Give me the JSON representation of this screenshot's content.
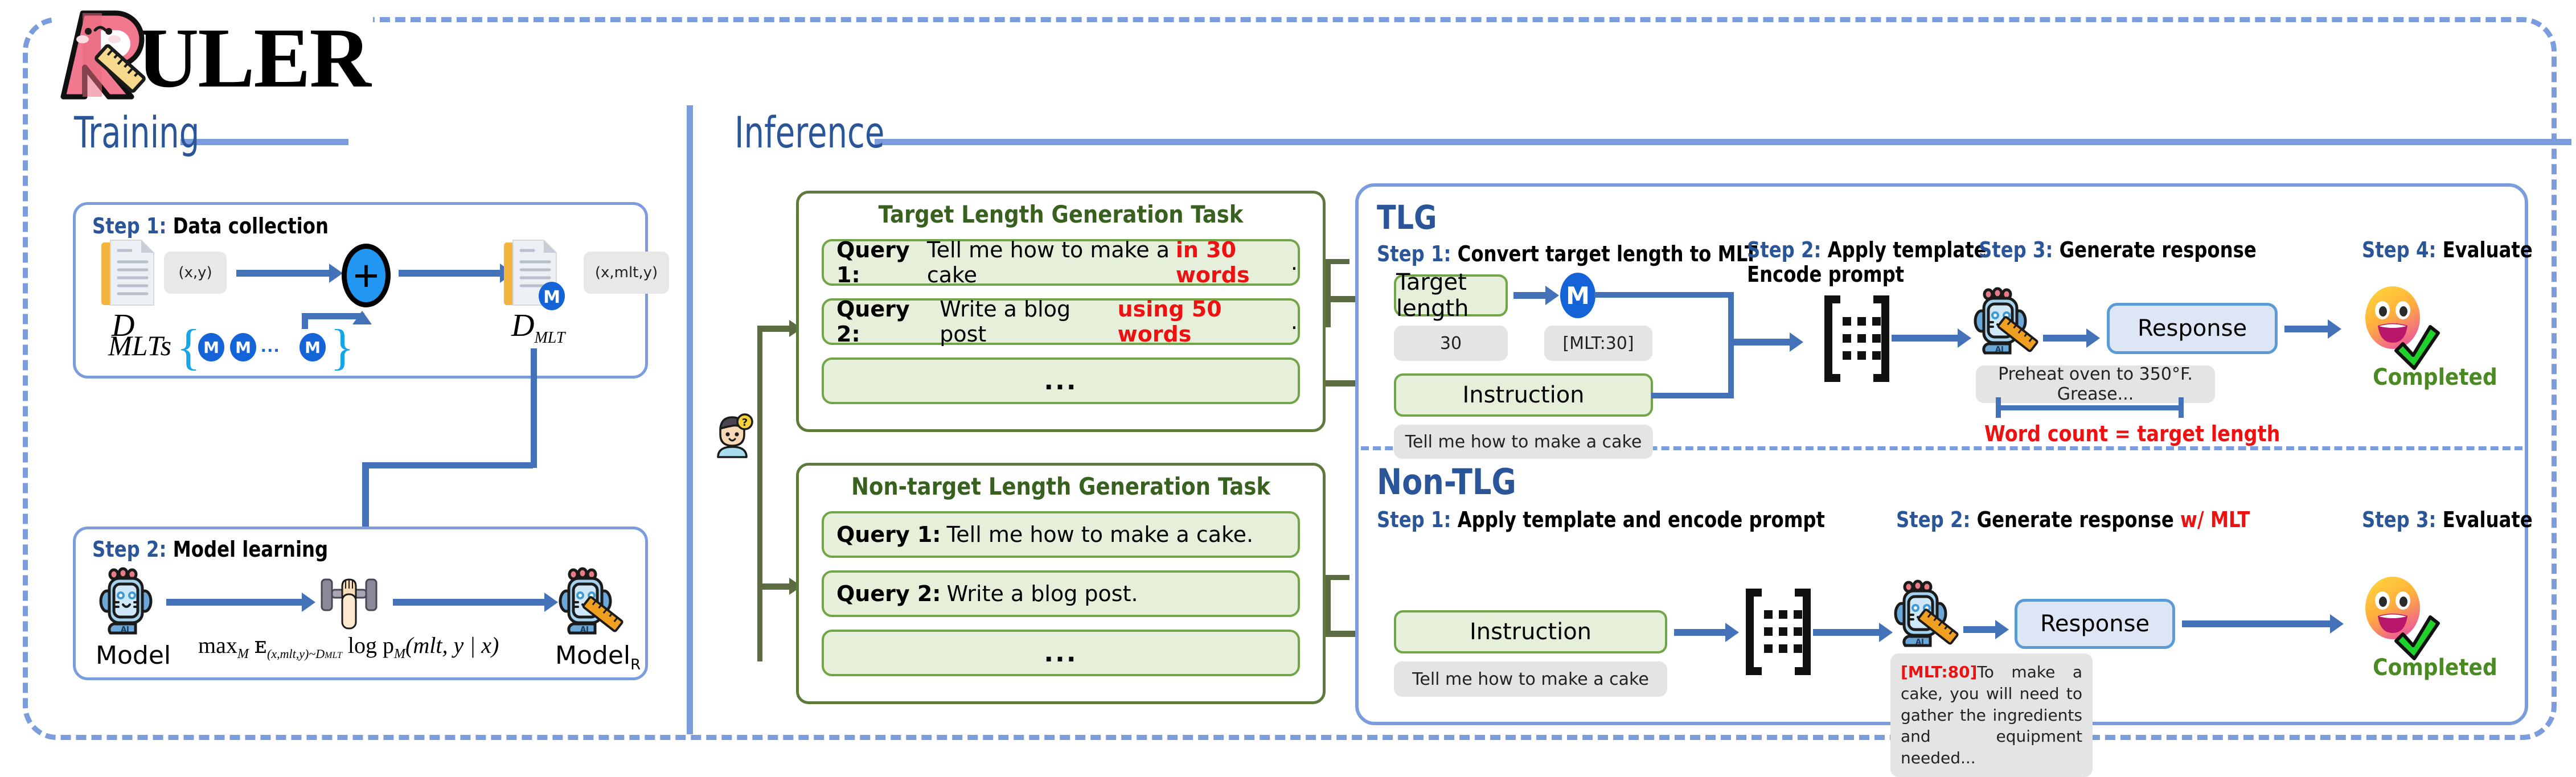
{
  "logo": {
    "letter": "R",
    "text": "ULER"
  },
  "sections": {
    "training": {
      "label": "Training"
    },
    "inference": {
      "label": "Inference"
    }
  },
  "training": {
    "step1": {
      "step_label": "Step 1:",
      "title": " Data collection",
      "dataset_symbol": "D",
      "dataset_pair": "(x,y)",
      "mlt_dataset_symbol": "D",
      "mlt_dataset_subscript": "MLT",
      "mlt_pair": "(x,mlt,y)",
      "plus": "+",
      "mlts_label": "MLTs",
      "mlts_open": "{",
      "mlts_close": "}",
      "mlt_badge": "M",
      "mlts_ellipsis": "..."
    },
    "step2": {
      "step_label": "Step 2:",
      "title": " Model learning",
      "model_in": "Model",
      "model_out": "Model",
      "model_out_sub": "R",
      "objective": "max",
      "objective_sub1": "M",
      "objective_e": "ᴇ",
      "objective_sub2": "(x,mlt,y)~D",
      "objective_sub3": "MLT",
      "objective_rest": "log p",
      "objective_p_sub": "M",
      "objective_args": "(mlt, y | x)"
    }
  },
  "inference": {
    "user_icon": "person-question-icon",
    "target_task": {
      "title": "Target Length Generation Task",
      "queries": [
        {
          "label": "Query 1:",
          "text": "Tell me how to make a cake",
          "highlight": "in 30 words",
          "suffix": "."
        },
        {
          "label": "Query 2:",
          "text": "Write a blog post",
          "highlight": "using 50 words",
          "suffix": "."
        },
        {
          "label": "",
          "text": "",
          "highlight": "",
          "suffix": "",
          "ellipsis": "..."
        }
      ]
    },
    "nontarget_task": {
      "title": "Non-target Length Generation Task",
      "queries": [
        {
          "label": "Query 1:",
          "text": "Tell me how to make a cake.",
          "highlight": "",
          "suffix": ""
        },
        {
          "label": "Query 2:",
          "text": "Write a blog post.",
          "highlight": "",
          "suffix": ""
        },
        {
          "label": "",
          "text": "",
          "highlight": "",
          "suffix": "",
          "ellipsis": "..."
        }
      ]
    },
    "tlg": {
      "heading": "TLG",
      "step1_label": "Step 1:",
      "step1_title": " Convert target length to MLT",
      "target_length_box": "Target length",
      "target_length_value": "30",
      "mlt_token": "[MLT:30]",
      "m_badge": "M",
      "instruction_box": "Instruction",
      "instruction_value": "Tell me how to make a cake",
      "step2_label": "Step 2:",
      "step2_title_line1": " Apply template",
      "step2_title_line2": "Encode prompt",
      "step3_label": "Step 3:",
      "step3_title": " Generate response",
      "response_box": "Response",
      "response_value": "Preheat oven to 350°F. Grease...",
      "measure_note": "Word count = target length",
      "step4_label": "Step 4:",
      "step4_title": " Evaluate",
      "completed": "Completed"
    },
    "nontlg": {
      "heading": "Non-TLG",
      "step1_label": "Step 1:",
      "step1_title": " Apply template and encode prompt",
      "instruction_box": "Instruction",
      "instruction_value": "Tell me how to make a cake",
      "step2_label": "Step 2:",
      "step2_title": " Generate response ",
      "step2_title_red": "w/ MLT",
      "response_box": "Response",
      "response_tag": "[MLT:80]",
      "response_value": "To make a cake, you will need to gather the ingredients and equipment needed...",
      "step3_label": "Step 3:",
      "step3_title": " Evaluate",
      "completed": "Completed"
    }
  },
  "colors": {
    "frame_blue": "#7b9ddd",
    "heading_blue": "#2a5699",
    "arrow_blue": "#4472b8",
    "green_border": "#72a548",
    "green_fill": "#e6efd9",
    "task_border": "#5d7a3c",
    "task_title": "#38601f",
    "red": "#ee1111",
    "completed_green": "#4a8a22",
    "badge_blue": "#1464d8",
    "gray_pill": "#e4e4e4",
    "response_fill": "#dce6f4",
    "response_border": "#5b9bd5",
    "green_arrow": "#5d6b43"
  }
}
